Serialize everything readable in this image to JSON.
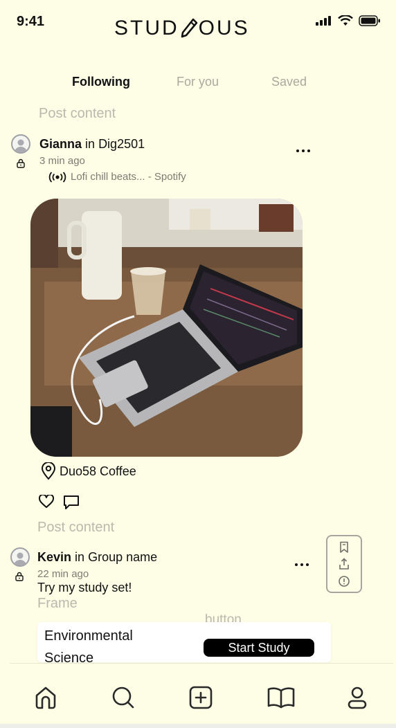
{
  "status_bar": {
    "time": "9:41"
  },
  "app": {
    "logo_text_left": "STUD",
    "logo_text_right": "OUS"
  },
  "tabs": [
    {
      "label": "Following",
      "active": true
    },
    {
      "label": "For you",
      "active": false
    },
    {
      "label": "Saved",
      "active": false
    }
  ],
  "post1": {
    "section_label": "Post content",
    "author": "Gianna",
    "in_word": "in",
    "group": "Dig2501",
    "time": "3 min ago",
    "music": "Lofi chill beats... - Spotify",
    "location": "Duo58 Coffee"
  },
  "post2": {
    "section_label": "Post content",
    "author": "Kevin",
    "in_word": "in",
    "group": "Group name",
    "time": "22 min ago",
    "text": "Try my study set!",
    "frame_label": "Frame",
    "button_label": "button",
    "card_title": "Environmental Science",
    "start_label": "Start Study"
  },
  "icons": {
    "nav": [
      "home-icon",
      "search-icon",
      "add-icon",
      "book-icon",
      "profile-icon"
    ],
    "panel": [
      "bookmark-icon",
      "share-icon",
      "report-icon"
    ]
  },
  "colors": {
    "background": "#fefde6",
    "accent": "#000000",
    "muted": "#b9b9ae"
  }
}
